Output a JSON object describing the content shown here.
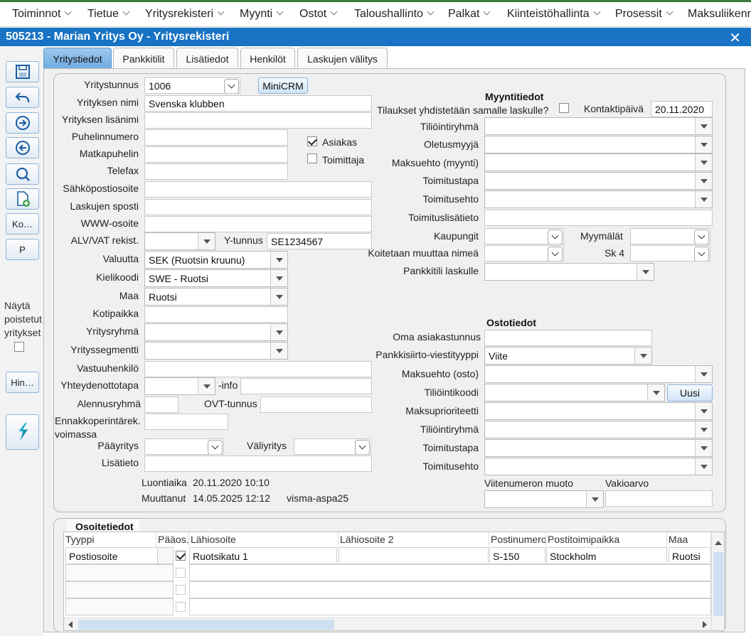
{
  "menu": [
    "Toiminnot",
    "Tietue",
    "Yritysrekisteri",
    "Myynti",
    "Ostot",
    "Taloushallinto",
    "Palkat",
    "Kiinteistöhallinta",
    "Prosessit",
    "Maksuliikenne"
  ],
  "window": {
    "title": "505213 - Marian Yritys Oy - Yritysrekisteri",
    "close": "✕"
  },
  "toolbar": {
    "ko_label": "Ko…",
    "p_label": "P",
    "show_deleted": "Näytä poistetut yritykset",
    "hin_label": "Hin…"
  },
  "tabs": [
    "Yritystiedot",
    "Pankkitilit",
    "Lisätiedot",
    "Henkilöt",
    "Laskujen välitys"
  ],
  "left": {
    "labels": {
      "yritystunnus": "Yritystunnus",
      "nimi": "Yrityksen nimi",
      "lisanimi": "Yrityksen lisänimi",
      "puhelin": "Puhelinnumero",
      "matka": "Matkapuhelin",
      "telefax": "Telefax",
      "sahkoposti": "Sähköpostiosoite",
      "laskusposti": "Laskujen sposti",
      "www": "WWW-osoite",
      "alv": "ALV/VAT rekist.",
      "ytunnus": "Y-tunnus",
      "valuutta": "Valuutta",
      "kielikoodi": "Kielikoodi",
      "maa": "Maa",
      "kotipaikka": "Kotipaikka",
      "yritysryhma": "Yritysryhmä",
      "segmentti": "Yrityssegmentti",
      "vastuuhenkilo": "Vastuuhenkilö",
      "yhteydenotto": "Yhteydenottotapa",
      "info": "-info",
      "alennus": "Alennusryhmä",
      "ovt": "OVT-tunnus",
      "ennakko1": "Ennakkoperintärek.",
      "ennakko2": "voimassa",
      "paayritys": "Pääyritys",
      "valiyritys": "Väliyritys",
      "lisatieto": "Lisätieto",
      "luontiaika": "Luontiaika",
      "muuttanut": "Muuttanut",
      "asiakas": "Asiakas",
      "toimittaja": "Toimittaja"
    },
    "values": {
      "yritystunnus": "1006",
      "nimi": "Svenska klubben",
      "ytunnus": "SE1234567",
      "valuutta": "SEK (Ruotsin kruunu)",
      "kielikoodi": "SWE - Ruotsi",
      "maa": "Ruotsi",
      "luontiaika": "20.11.2020 10:10",
      "muuttanut_time": "14.05.2025 12:12",
      "muuttanut_user": "visma-aspa25"
    },
    "minicrm": "MiniCRM"
  },
  "sales": {
    "title": "Myyntitiedot",
    "merge_label": "Tilaukset yhdistetään samalle laskulle?",
    "kontakti_label": "Kontaktipäivä",
    "kontakti_value": "20.11.2020",
    "tiliointiryhma": "Tiliöintiryhmä",
    "oletusmyyja": "Oletusmyyjä",
    "maksuehto": "Maksuehto (myynti)",
    "toimitustapa": "Toimitustapa",
    "toimitusehto": "Toimitusehto",
    "toimituslisatieto": "Toimituslisätieto",
    "kaupungit": "Kaupungit",
    "myymalat": "Myymälät",
    "koitetaan": "Koitetaan muuttaa nimeä",
    "sk4": "Sk 4",
    "pankkitili": "Pankkitili laskulle"
  },
  "purchase": {
    "title": "Ostotiedot",
    "oma": "Oma asiakastunnus",
    "pankkisiirto": "Pankkisiirto-viestityyppi",
    "pankkisiirto_value": "Viite",
    "maksuehto": "Maksuehto (osto)",
    "tiliointikoodi": "Tiliöintikoodi",
    "uusi": "Uusi",
    "maksuprioriteetti": "Maksuprioriteetti",
    "tiliointiryhma": "Tiliöintiryhmä",
    "toimitustapa": "Toimitustapa",
    "toimitusehto": "Toimitusehto",
    "viite": "Viitenumeron muoto",
    "vakio": "Vakioarvo"
  },
  "address": {
    "title": "Osoitetiedot",
    "headers": [
      "Tyyppi",
      "Pääos.",
      "Lähiosoite",
      "Lähiosoite 2",
      "Postinumero",
      "Postitoimipaikka",
      "Maa"
    ],
    "row": {
      "tyyppi": "Postiosoite",
      "lahiosoite": "Ruotsikatu 1",
      "postinumero": "S-150",
      "postitoimipaikka": "Stockholm",
      "maa": "Ruotsi"
    }
  }
}
